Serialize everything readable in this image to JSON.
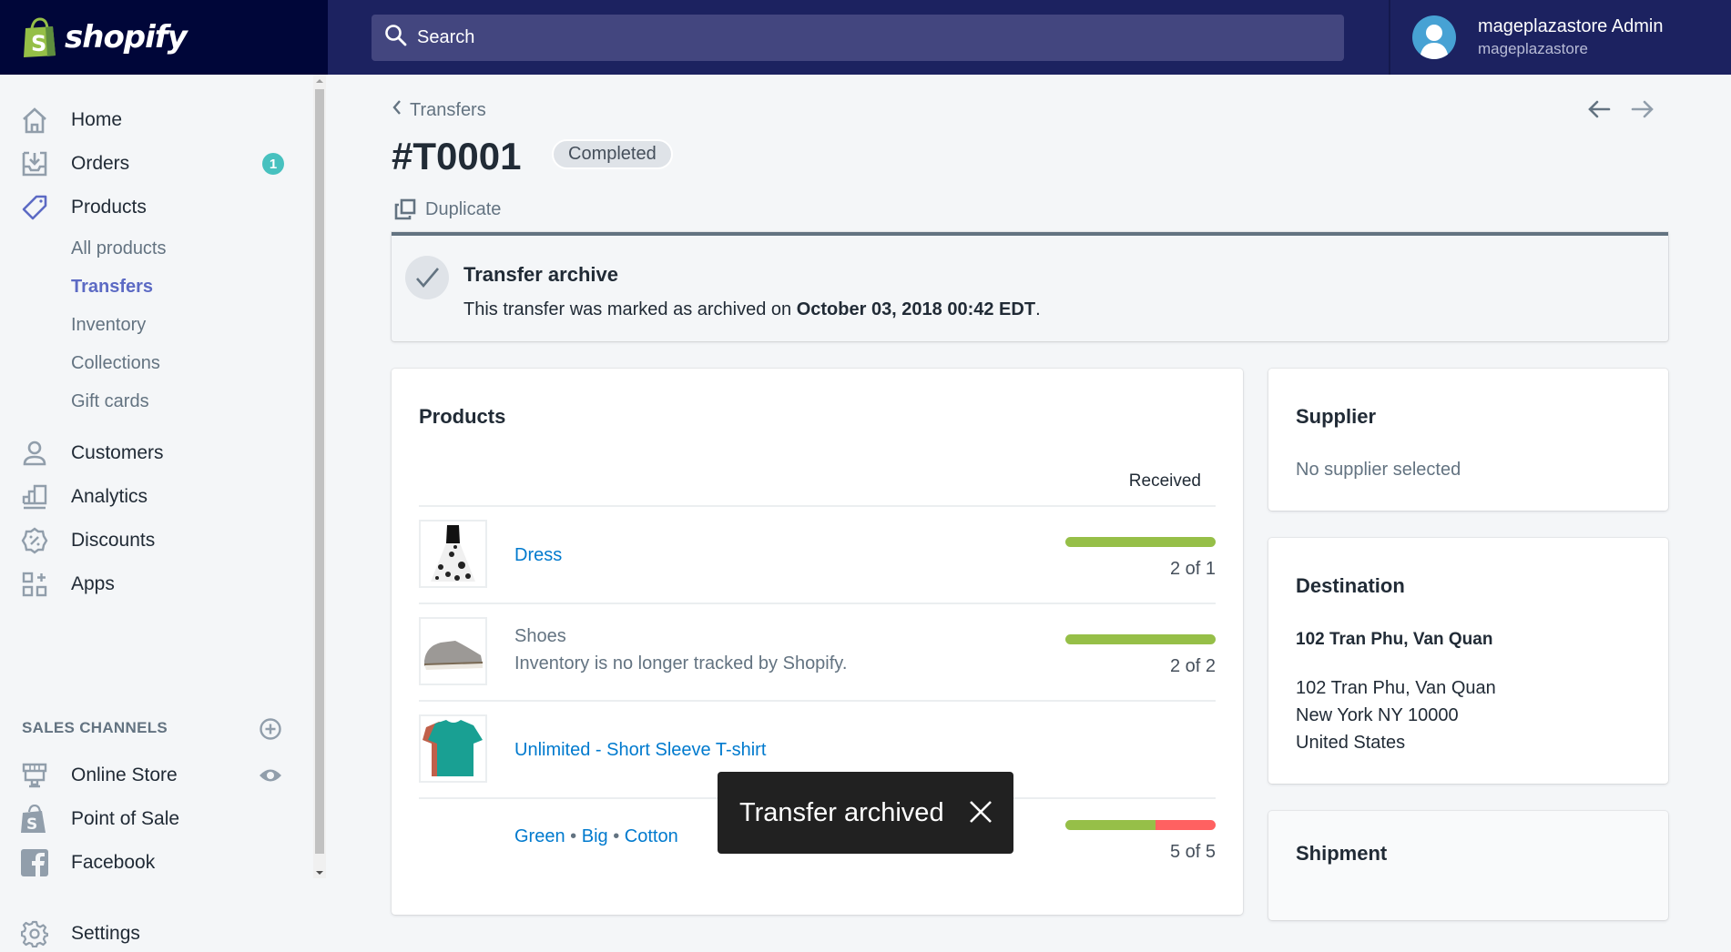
{
  "app": {
    "logo_text": "shopify",
    "brand_colors": {
      "topbar": "#1c2260",
      "logo_bg": "#000639",
      "accent": "#5c6ac4",
      "link": "#007ace"
    }
  },
  "search": {
    "placeholder": "Search",
    "icon": "search-icon"
  },
  "user": {
    "name": "mageplazastore Admin",
    "store": "mageplazastore",
    "icon": "avatar-icon"
  },
  "sidebar": {
    "items": [
      {
        "label": "Home",
        "icon": "home-icon"
      },
      {
        "label": "Orders",
        "icon": "orders-icon",
        "badge": "1"
      },
      {
        "label": "Products",
        "icon": "tag-icon"
      },
      {
        "label": "Customers",
        "icon": "customer-icon"
      },
      {
        "label": "Analytics",
        "icon": "analytics-icon"
      },
      {
        "label": "Discounts",
        "icon": "discount-icon"
      },
      {
        "label": "Apps",
        "icon": "apps-icon"
      }
    ],
    "product_subitems": [
      {
        "label": "All products"
      },
      {
        "label": "Transfers",
        "active": true
      },
      {
        "label": "Inventory"
      },
      {
        "label": "Collections"
      },
      {
        "label": "Gift cards"
      }
    ],
    "sales_channels_title": "SALES CHANNELS",
    "channels": [
      {
        "label": "Online Store",
        "icon": "store-icon",
        "action_icon": "eye-icon"
      },
      {
        "label": "Point of Sale",
        "icon": "pos-bag-icon"
      },
      {
        "label": "Facebook",
        "icon": "facebook-icon"
      }
    ],
    "settings": {
      "label": "Settings",
      "icon": "gear-icon"
    }
  },
  "page": {
    "breadcrumb": "Transfers",
    "title": "#T0001",
    "status": "Completed",
    "duplicate_label": "Duplicate"
  },
  "archive_banner": {
    "title": "Transfer archive",
    "text_prefix": "This transfer was marked as archived on ",
    "date": "October 03, 2018 00:42 EDT",
    "text_suffix": "."
  },
  "products_card": {
    "title": "Products",
    "received_header": "Received",
    "rows": [
      {
        "name": "Dress",
        "link": true,
        "received": 2,
        "total": 1,
        "qty_label": "2 of 1",
        "green_fraction": 1.0
      },
      {
        "name": "Shoes",
        "link": false,
        "note": "Inventory is no longer tracked by Shopify.",
        "received": 2,
        "total": 2,
        "qty_label": "2 of 2",
        "green_fraction": 1.0
      },
      {
        "name": "Unlimited - Short Sleeve T-shirt",
        "link": true
      },
      {
        "variant": [
          "Green",
          "Big",
          "Cotton"
        ],
        "separator": "•",
        "qty_label": "5 of 5",
        "green_fraction": 0.6,
        "red_fraction": 0.4
      }
    ]
  },
  "supplier_card": {
    "title": "Supplier",
    "text": "No supplier selected"
  },
  "destination_card": {
    "title": "Destination",
    "name": "102 Tran Phu, Van Quan",
    "address": [
      "102 Tran Phu, Van Quan",
      "New York NY 10000",
      "United States"
    ]
  },
  "shipment_card": {
    "title": "Shipment"
  },
  "toast": {
    "text": "Transfer archived"
  }
}
